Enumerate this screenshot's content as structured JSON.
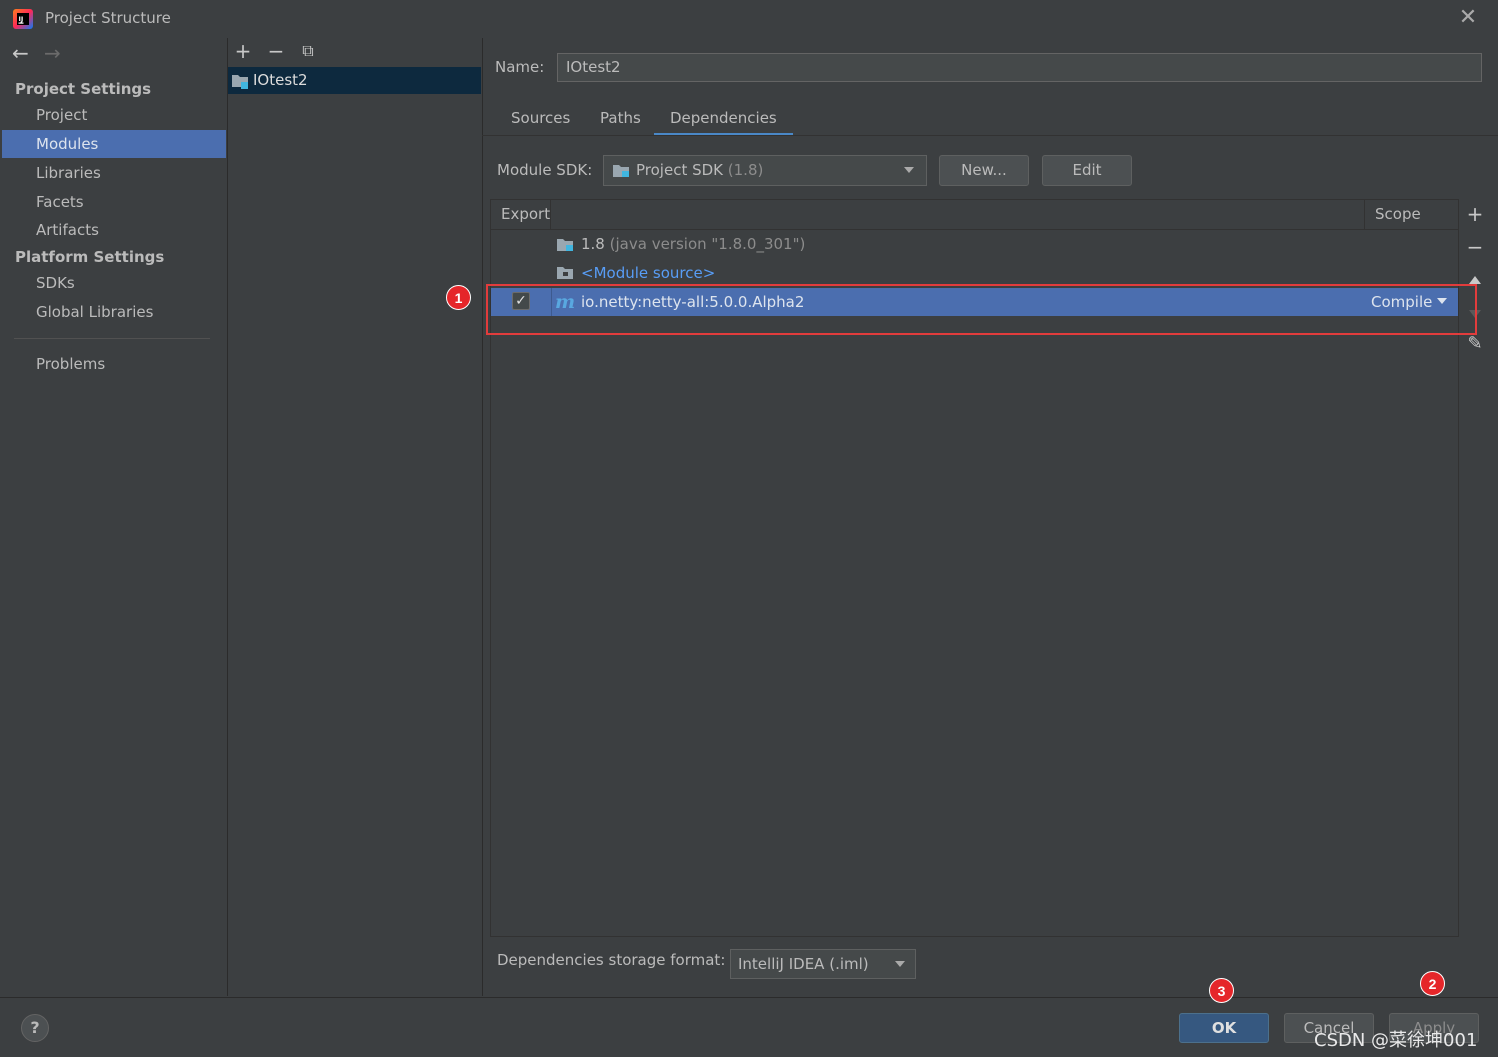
{
  "window": {
    "title": "Project Structure",
    "close_glyph": "✕"
  },
  "leftnav": {
    "back_glyph": "←",
    "forward_glyph": "→",
    "project_settings_header": "Project Settings",
    "platform_settings_header": "Platform Settings",
    "items": [
      {
        "label": "Project"
      },
      {
        "label": "Modules"
      },
      {
        "label": "Libraries"
      },
      {
        "label": "Facets"
      },
      {
        "label": "Artifacts"
      },
      {
        "label": "SDKs"
      },
      {
        "label": "Global Libraries"
      },
      {
        "label": "Problems"
      }
    ],
    "selected": "Modules"
  },
  "modules_panel": {
    "add_glyph": "+",
    "remove_glyph": "−",
    "copy_glyph": "⧉",
    "modules": [
      {
        "label": "IOtest2"
      }
    ]
  },
  "module": {
    "name_label": "Name:",
    "name_value": "IOtest2",
    "tabs": [
      {
        "label": "Sources"
      },
      {
        "label": "Paths"
      },
      {
        "label": "Dependencies"
      }
    ],
    "active_tab": "Dependencies",
    "sdk_label": "Module SDK:",
    "sdk_value": "Project SDK",
    "sdk_detail": "(1.8)",
    "new_button": "New...",
    "edit_button": "Edit"
  },
  "dependencies": {
    "header_export": "Export",
    "header_scope": "Scope",
    "rows": [
      {
        "name": "1.8",
        "detail": "(java version \"1.8.0_301\")"
      },
      {
        "name": "<Module source>"
      },
      {
        "name": "io.netty:netty-all:5.0.0.Alpha2",
        "export_checked": true,
        "scope": "Compile",
        "icon_letter": "m",
        "check_glyph": "✓"
      }
    ],
    "side_add_glyph": "+",
    "side_remove_glyph": "−",
    "side_edit_glyph": "✎",
    "storage_label": "Dependencies storage format:",
    "storage_value": "IntelliJ IDEA (.iml)"
  },
  "footer": {
    "help_glyph": "?",
    "ok_button": "OK",
    "cancel_button": "Cancel",
    "apply_button": "Apply"
  },
  "annotations": {
    "badge1": "1",
    "badge2": "2",
    "badge3": "3",
    "highlight_color": "#e23c3c"
  },
  "watermark": "CSDN @菜徐坤001",
  "colors": {
    "background": "#3c3f41",
    "selection": "#4b6eaf",
    "accent_tab": "#4a88c7",
    "link": "#589df6",
    "ok_button": "#365880"
  }
}
